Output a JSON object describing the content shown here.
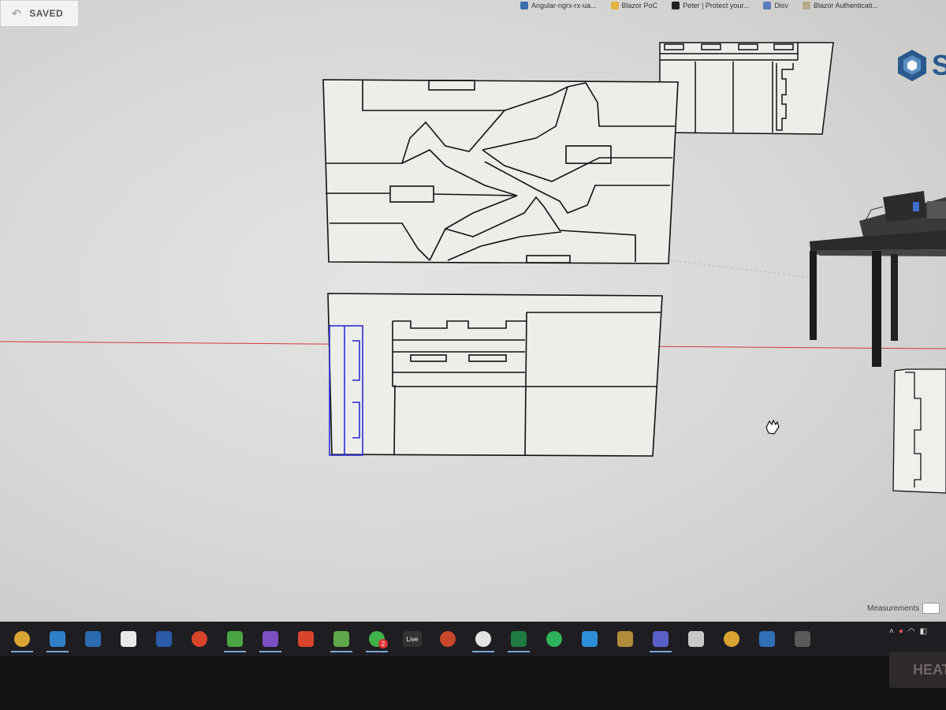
{
  "status": {
    "saved_label": "SAVED"
  },
  "bookmarks": [
    {
      "label": "Angular-ngrx-rx-ua...",
      "icon": "arrow-icon",
      "color": "#3b6fb0"
    },
    {
      "label": "Blazor PoC",
      "icon": "folder-icon",
      "color": "#e3b341"
    },
    {
      "label": "Peter | Protect your...",
      "icon": "site-icon",
      "color": "#222222"
    },
    {
      "label": "Disv",
      "icon": "vs-icon",
      "color": "#5b7bbd"
    },
    {
      "label": "Blazor Authenticati...",
      "icon": "folder-icon",
      "color": "#b9a98a"
    }
  ],
  "app": {
    "logo_letter": "S",
    "logo_icon": "sketchup-logo-icon",
    "accent": "#2a5a8c"
  },
  "measurements": {
    "label": "Measurements",
    "value": ""
  },
  "selection_color": "#2b2bd6",
  "axis_color": "#d23a3a",
  "taskbar": [
    {
      "name": "chrome",
      "icon": "chrome-icon",
      "color": "#d9a431",
      "active": true,
      "glyph": ""
    },
    {
      "name": "vscode",
      "icon": "vscode-icon",
      "color": "#2f80c8",
      "active": true,
      "glyph": ""
    },
    {
      "name": "git",
      "icon": "git-icon",
      "color": "#2c6bb0",
      "active": false,
      "glyph": ""
    },
    {
      "name": "explorer",
      "icon": "window-icon",
      "color": "#e9e9e9",
      "active": false,
      "glyph": ""
    },
    {
      "name": "powershell",
      "icon": "powershell-icon",
      "color": "#2a5aa8",
      "active": false,
      "glyph": ""
    },
    {
      "name": "ubuntu",
      "icon": "ubuntu-icon",
      "color": "#d8452a",
      "active": false,
      "glyph": ""
    },
    {
      "name": "tool",
      "icon": "x-tool-icon",
      "color": "#49a544",
      "active": true,
      "glyph": ""
    },
    {
      "name": "visual-studio",
      "icon": "visual-studio-icon",
      "color": "#7c4fc5",
      "active": true,
      "glyph": ""
    },
    {
      "name": "lambda",
      "icon": "lambda-icon",
      "color": "#d8452a",
      "active": false,
      "glyph": ""
    },
    {
      "name": "notepad",
      "icon": "notepad-icon",
      "color": "#5fa84a",
      "active": true,
      "glyph": ""
    },
    {
      "name": "whatsapp",
      "icon": "whatsapp-icon",
      "color": "#3fb24a",
      "active": true,
      "glyph": ""
    },
    {
      "name": "live",
      "icon": "live-icon",
      "color": "#333333",
      "active": false,
      "glyph": "Live"
    },
    {
      "name": "powerpoint",
      "icon": "powerpoint-icon",
      "color": "#c9472b",
      "active": false,
      "glyph": ""
    },
    {
      "name": "slack",
      "icon": "slack-icon",
      "color": "#e3e3e3",
      "active": true,
      "glyph": ""
    },
    {
      "name": "excel",
      "icon": "excel-icon",
      "color": "#1f7a44",
      "active": true,
      "glyph": ""
    },
    {
      "name": "spotify",
      "icon": "spotify-icon",
      "color": "#2fb35a",
      "active": false,
      "glyph": ""
    },
    {
      "name": "azure",
      "icon": "azure-icon",
      "color": "#2e8fd8",
      "active": false,
      "glyph": ""
    },
    {
      "name": "tools",
      "icon": "tools-icon",
      "color": "#b28b3a",
      "active": false,
      "glyph": ""
    },
    {
      "name": "teams",
      "icon": "teams-icon",
      "color": "#5a5fc8",
      "active": true,
      "glyph": ""
    },
    {
      "name": "files",
      "icon": "files-icon",
      "color": "#c8c8c8",
      "active": false,
      "glyph": ""
    },
    {
      "name": "chrome-2",
      "icon": "chrome-icon",
      "color": "#d9a431",
      "active": false,
      "glyph": ""
    },
    {
      "name": "photos",
      "icon": "photos-icon",
      "color": "#2e6fb8",
      "active": false,
      "glyph": ""
    },
    {
      "name": "calculator",
      "icon": "calculator-icon",
      "color": "#5a5a5a",
      "active": false,
      "glyph": ""
    }
  ],
  "whatsapp_badge": "2",
  "tray_icons": [
    "chevron-up-icon",
    "cloud-icon",
    "wifi-icon",
    "speaker-icon"
  ],
  "monitor_label": "HEAT"
}
